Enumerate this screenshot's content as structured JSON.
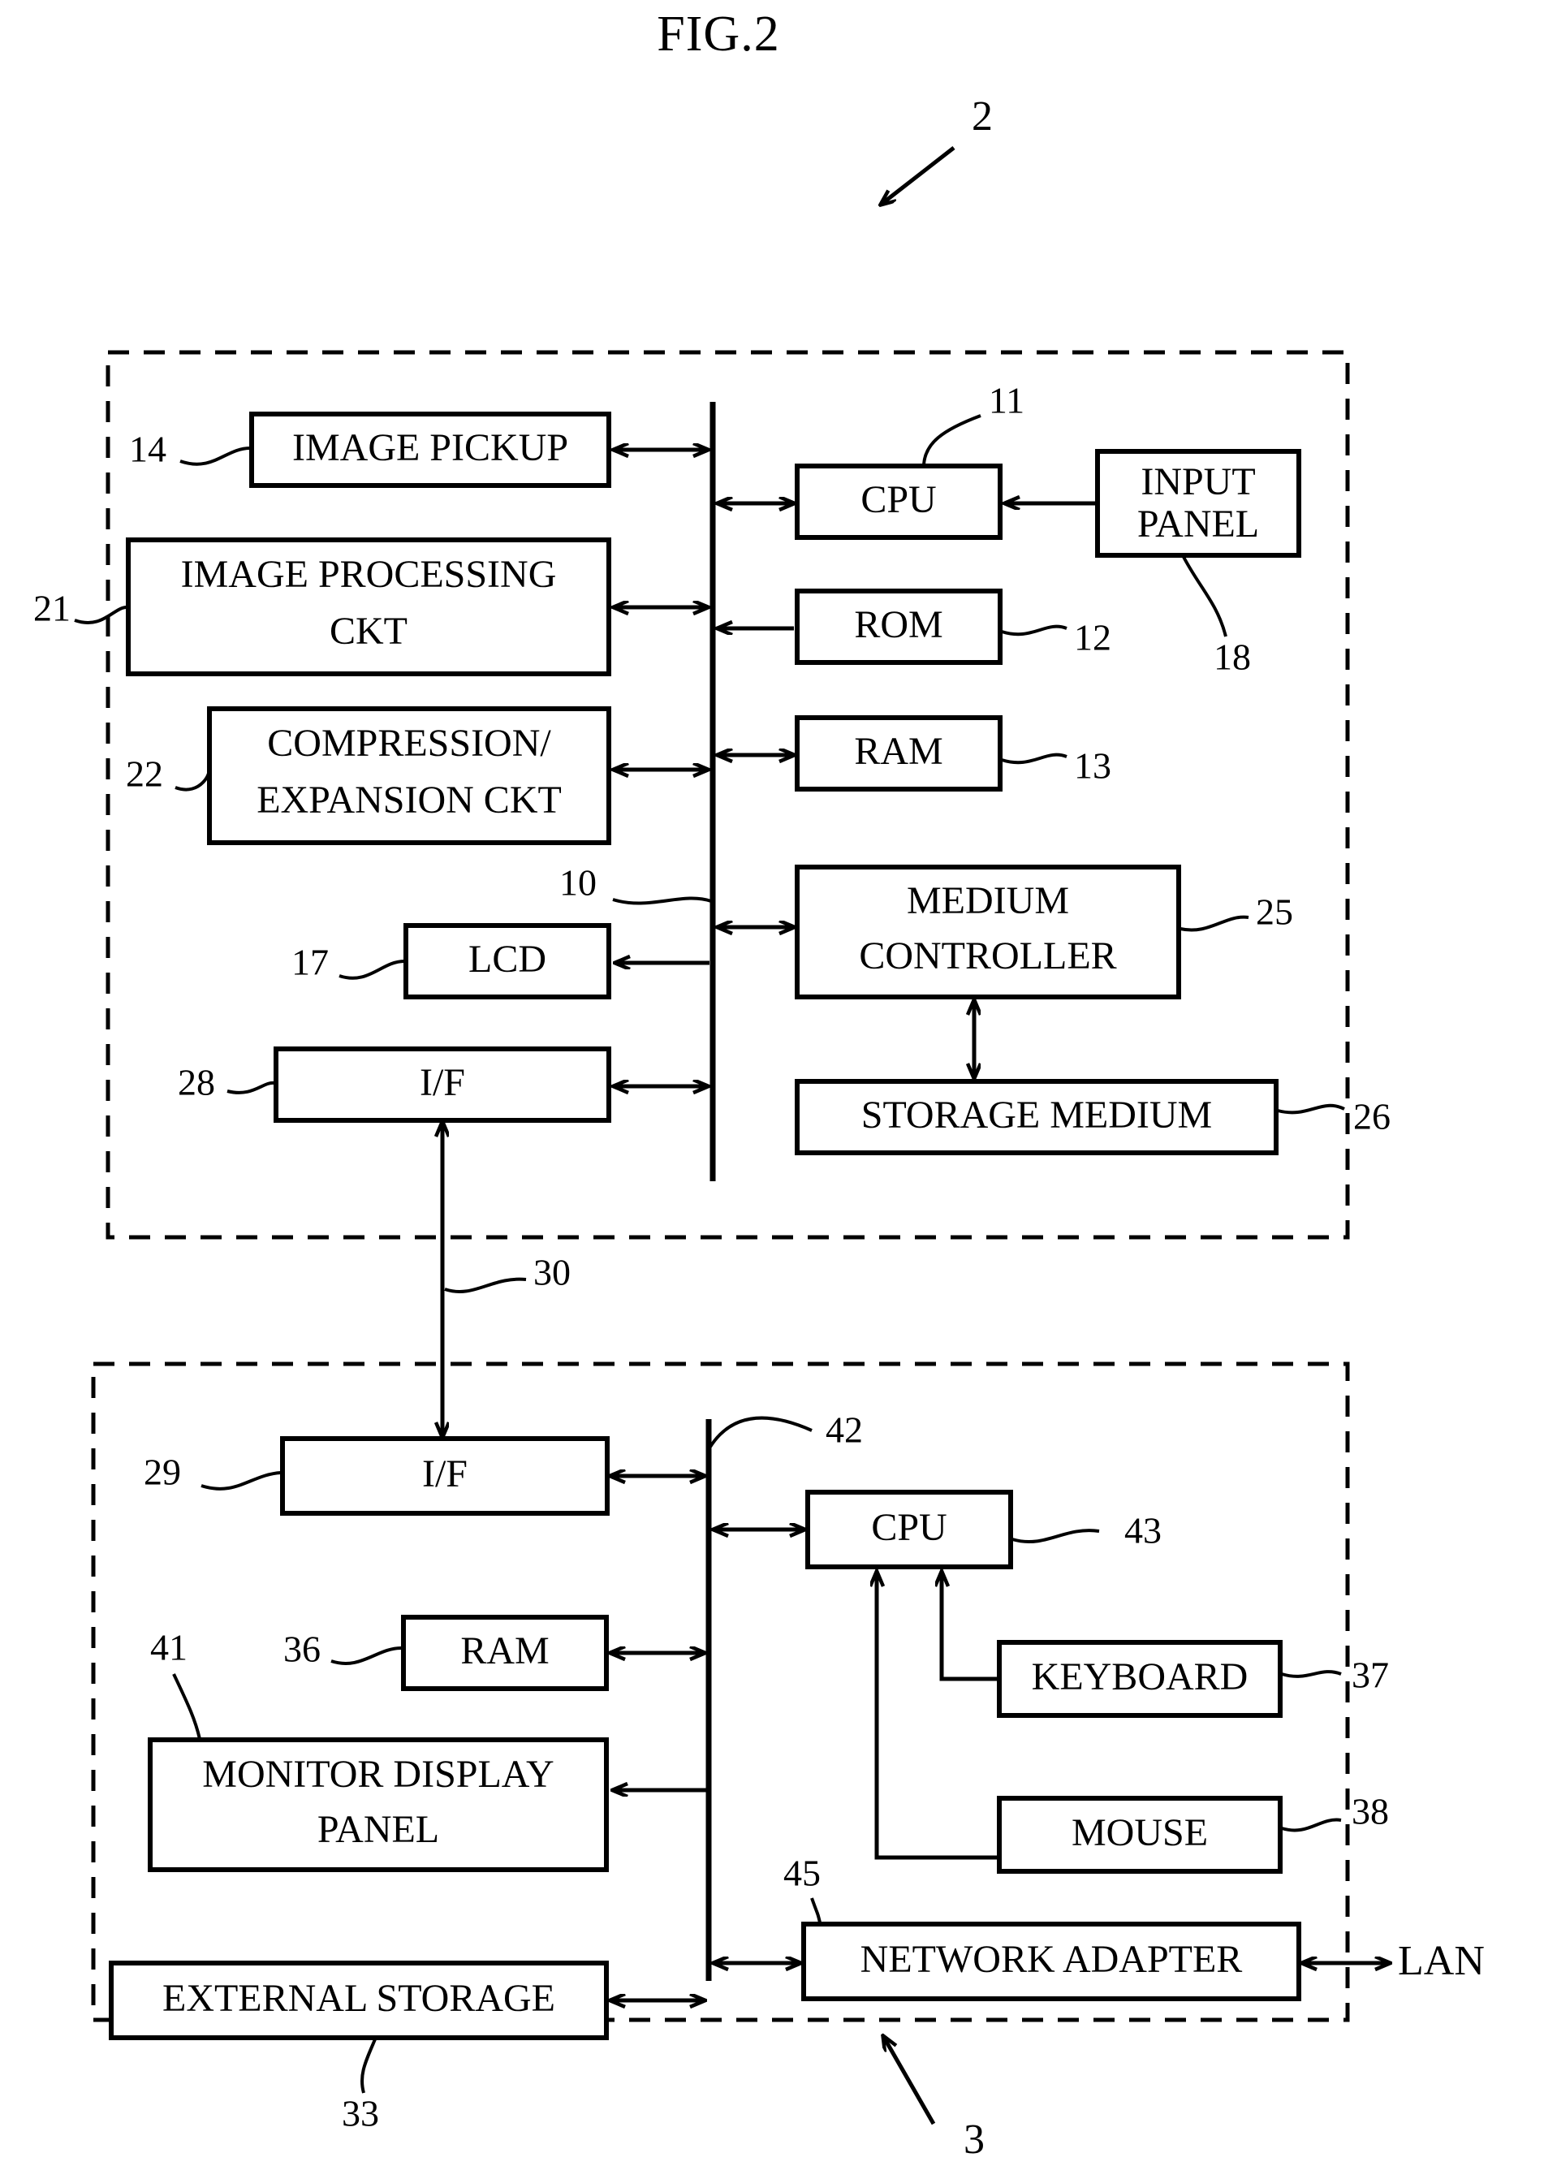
{
  "figure": {
    "title": "FIG.2",
    "top_reference": "2",
    "bottom_reference": "3"
  },
  "upper_unit": {
    "name": "camera-unit",
    "bus_reference": "10",
    "blocks": [
      {
        "id": "image-pickup",
        "label": "IMAGE PICKUP",
        "ref": "14",
        "ref_side": "left",
        "arrow": "bidirectional"
      },
      {
        "id": "image-processing-ckt",
        "label": "IMAGE PROCESSING\nCKT",
        "ref": "21",
        "ref_side": "left",
        "arrow": "bidirectional"
      },
      {
        "id": "compression-expansion-ckt",
        "label": "COMPRESSION/\nEXPANSION CKT",
        "ref": "22",
        "ref_side": "left",
        "arrow": "bidirectional"
      },
      {
        "id": "lcd",
        "label": "LCD",
        "ref": "17",
        "ref_side": "left",
        "arrow": "to-block"
      },
      {
        "id": "interface-upper",
        "label": "I/F",
        "ref": "28",
        "ref_side": "left",
        "arrow": "bidirectional"
      },
      {
        "id": "cpu-upper",
        "label": "CPU",
        "ref": "11",
        "ref_side": "top",
        "arrow": "bidirectional"
      },
      {
        "id": "input-panel",
        "label": "INPUT\nPANEL",
        "ref": "18",
        "ref_side": "bottom",
        "arrow": "to-cpu"
      },
      {
        "id": "rom",
        "label": "ROM",
        "ref": "12",
        "ref_side": "right",
        "arrow": "to-bus"
      },
      {
        "id": "ram-upper",
        "label": "RAM",
        "ref": "13",
        "ref_side": "right",
        "arrow": "bidirectional"
      },
      {
        "id": "medium-controller",
        "label": "MEDIUM\nCONTROLLER",
        "ref": "25",
        "ref_side": "right",
        "arrow": "bidirectional"
      },
      {
        "id": "storage-medium",
        "label": "STORAGE MEDIUM",
        "ref": "26",
        "ref_side": "right",
        "arrow": "bidirectional"
      }
    ]
  },
  "interconnect": {
    "reference": "30",
    "description": "I/F to I/F link"
  },
  "lower_unit": {
    "name": "computer-unit",
    "bus_reference": "42",
    "external_label": "LAN",
    "blocks": [
      {
        "id": "interface-lower",
        "label": "I/F",
        "ref": "29",
        "ref_side": "left",
        "arrow": "bidirectional"
      },
      {
        "id": "ram-lower",
        "label": "RAM",
        "ref": "36",
        "ref_side": "left",
        "arrow": "bidirectional"
      },
      {
        "id": "monitor-display-panel",
        "label": "MONITOR DISPLAY\nPANEL",
        "ref": "41",
        "ref_side": "top",
        "arrow": "to-block"
      },
      {
        "id": "external-storage",
        "label": "EXTERNAL STORAGE",
        "ref": "33",
        "ref_side": "bottom",
        "arrow": "bidirectional"
      },
      {
        "id": "cpu-lower",
        "label": "CPU",
        "ref": "43",
        "ref_side": "right",
        "arrow": "bidirectional"
      },
      {
        "id": "keyboard",
        "label": "KEYBOARD",
        "ref": "37",
        "ref_side": "right",
        "arrow": "to-cpu"
      },
      {
        "id": "mouse",
        "label": "MOUSE",
        "ref": "38",
        "ref_side": "right",
        "arrow": "to-cpu"
      },
      {
        "id": "network-adapter",
        "label": "NETWORK ADAPTER",
        "ref": "45",
        "ref_side": "top",
        "arrow": "bidirectional"
      }
    ]
  },
  "labels": {
    "image_pickup": "IMAGE PICKUP",
    "image_processing_line1": "IMAGE PROCESSING",
    "image_processing_line2": "CKT",
    "compression_line1": "COMPRESSION/",
    "compression_line2": "EXPANSION CKT",
    "lcd": "LCD",
    "if_upper": "I/F",
    "cpu_upper": "CPU",
    "input_panel_line1": "INPUT",
    "input_panel_line2": "PANEL",
    "rom": "ROM",
    "ram_upper": "RAM",
    "medium_controller_line1": "MEDIUM",
    "medium_controller_line2": "CONTROLLER",
    "storage_medium": "STORAGE MEDIUM",
    "if_lower": "I/F",
    "ram_lower": "RAM",
    "monitor_line1": "MONITOR DISPLAY",
    "monitor_line2": "PANEL",
    "external_storage": "EXTERNAL STORAGE",
    "cpu_lower": "CPU",
    "keyboard": "KEYBOARD",
    "mouse": "MOUSE",
    "network_adapter": "NETWORK ADAPTER",
    "lan": "LAN"
  },
  "refs": {
    "r2": "2",
    "r3": "3",
    "r10": "10",
    "r11": "11",
    "r12": "12",
    "r13": "13",
    "r14": "14",
    "r17": "17",
    "r18": "18",
    "r21": "21",
    "r22": "22",
    "r25": "25",
    "r26": "26",
    "r28": "28",
    "r29": "29",
    "r30": "30",
    "r33": "33",
    "r36": "36",
    "r37": "37",
    "r38": "38",
    "r41": "41",
    "r42": "42",
    "r43": "43",
    "r45": "45"
  },
  "colors": {
    "ink": "#000000",
    "paper": "#ffffff"
  }
}
